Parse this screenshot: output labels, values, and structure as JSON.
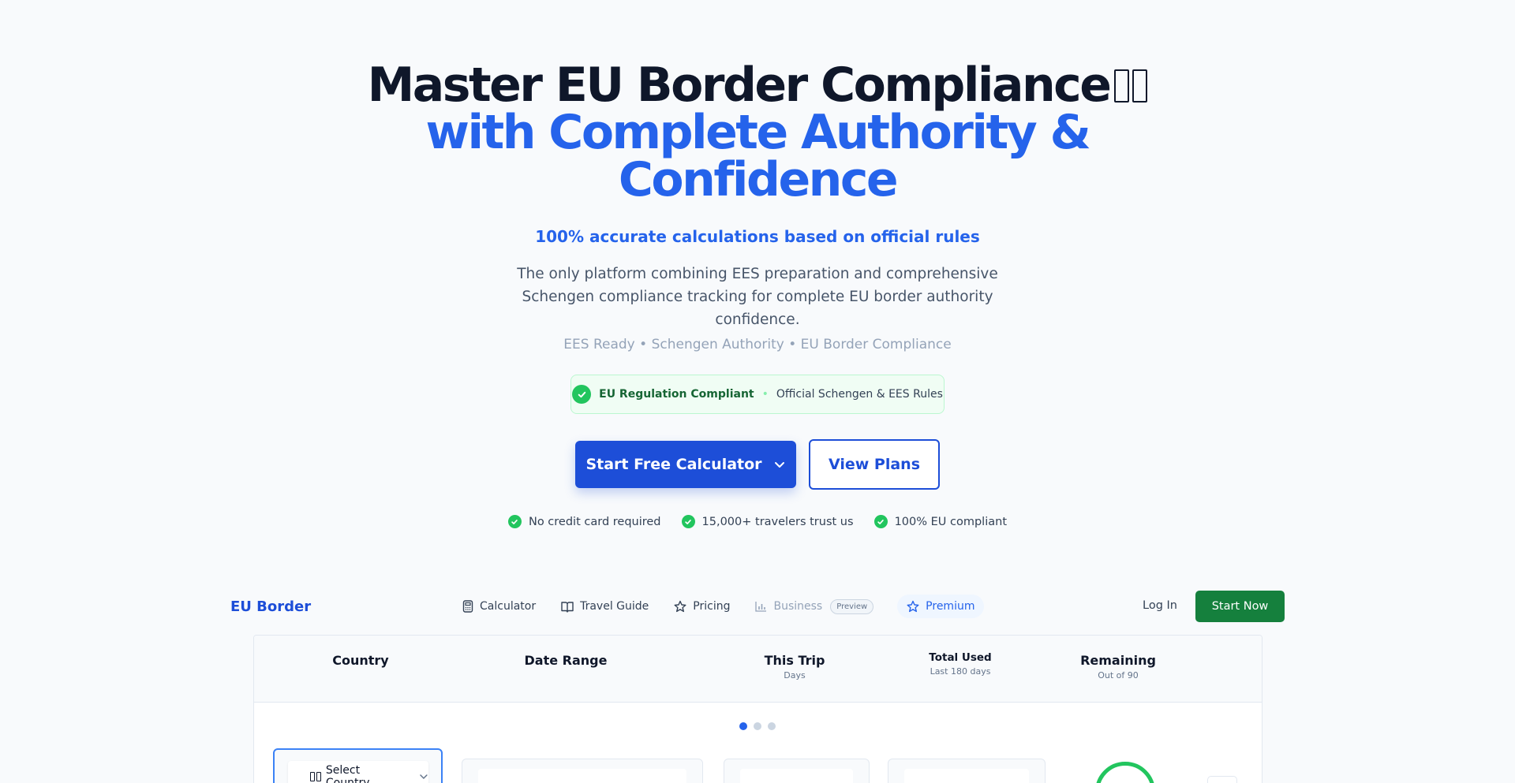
{
  "hero": {
    "title_line1": "Master EU Border Compliance",
    "title_line2": "with Complete Authority &",
    "title_line3": "Confidence",
    "accuracy": "100% accurate calculations based on official rules",
    "description": "The only platform combining EES preparation and comprehensive Schengen compliance tracking for complete EU border authority confidence.",
    "tagline": "EES Ready • Schengen Authority • EU Border Compliance",
    "badge_primary": "EU Regulation Compliant",
    "badge_separator": "•",
    "badge_secondary": "Official Schengen & EES Rules",
    "cta_primary": "Start Free Calculator",
    "cta_secondary": "View Plans",
    "trust": [
      "No credit card required",
      "15,000+ travelers trust us",
      "100% EU compliant"
    ]
  },
  "nav": {
    "brand": "EU Border",
    "links": [
      "Calculator",
      "Travel Guide",
      "Pricing",
      "Business"
    ],
    "preview": "Preview",
    "premium": "Premium",
    "login": "Log In",
    "start": "Start Now"
  },
  "panel": {
    "columns": [
      {
        "title": "Country",
        "sub": ""
      },
      {
        "title": "Date Range",
        "sub": ""
      },
      {
        "title": "This Trip",
        "sub": "Days"
      },
      {
        "title": "Total Used",
        "sub": "Last 180 days"
      },
      {
        "title": "Remaining",
        "sub": "Out of 90"
      }
    ],
    "select_country": "Select Country",
    "active_slide": 1,
    "slide_count": 3
  },
  "colors": {
    "primary": "#2563eb",
    "dark": "#0f172a",
    "success": "#22c55e",
    "cta_green": "#15803d"
  },
  "icons": [
    "check-circle-icon",
    "chevron-down-icon",
    "calculator-icon",
    "book-icon",
    "star-icon",
    "bar-chart-icon",
    "flag-icon"
  ]
}
